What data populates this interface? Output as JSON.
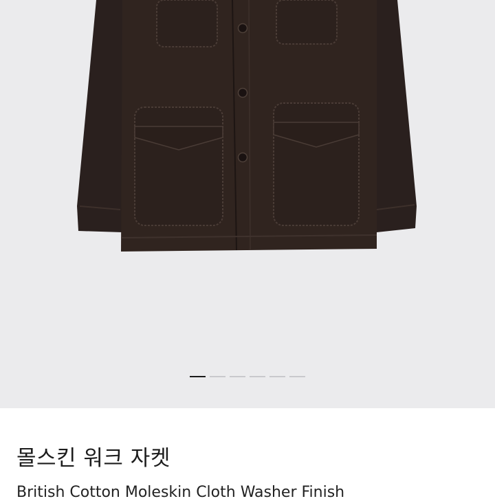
{
  "gallery": {
    "slide_count": 6,
    "active_slide": 1,
    "background_color": "#ebebed",
    "jacket_color": "#2d2220"
  },
  "product": {
    "title": "몰스킨 워크 자켓",
    "subtitle": "British Cotton Moleskin Cloth Washer Finish"
  }
}
